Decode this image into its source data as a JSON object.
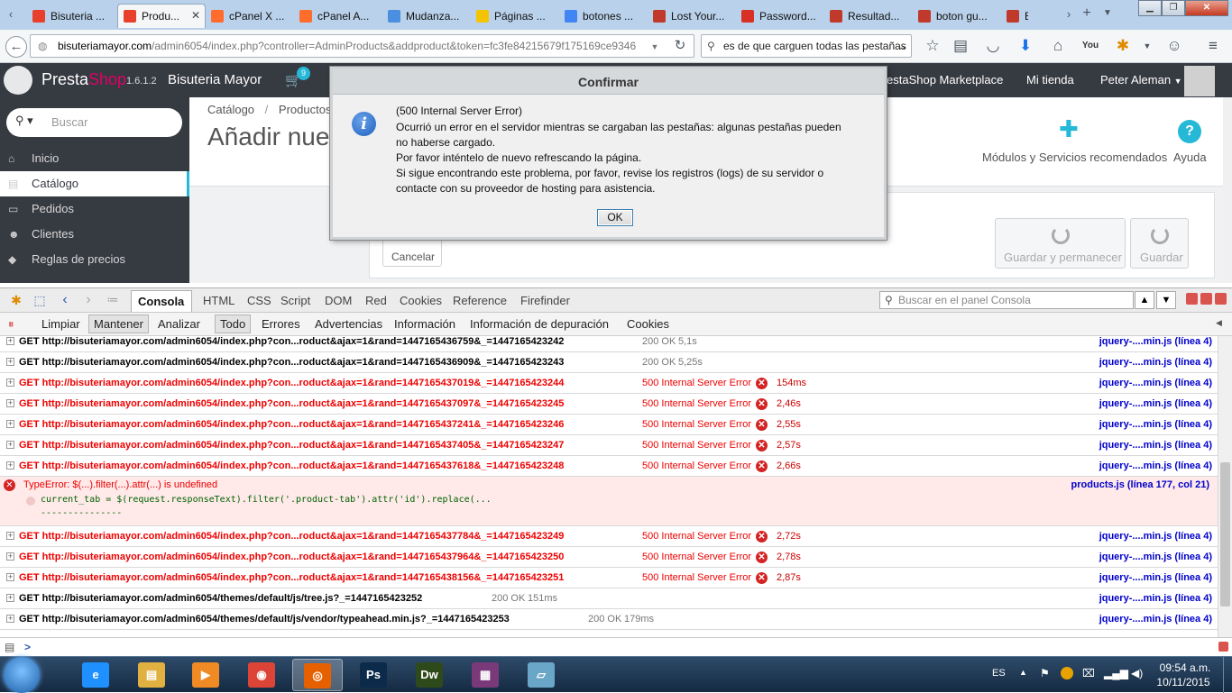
{
  "browser": {
    "tabs": [
      {
        "label": "Bisuteria ...",
        "color": "#e8402c"
      },
      {
        "label": "Produ...",
        "color": "#e8402c"
      },
      {
        "label": "cPanel X ...",
        "color": "#ff6c2c"
      },
      {
        "label": "cPanel A...",
        "color": "#ff6c2c"
      },
      {
        "label": "Mudanza...",
        "color": "#4a8fe0"
      },
      {
        "label": "Páginas ...",
        "color": "#f5c400"
      },
      {
        "label": "botones ...",
        "color": "#4285f4"
      },
      {
        "label": "Lost Your...",
        "color": "#c0392b"
      },
      {
        "label": "Password...",
        "color": "#d93025"
      },
      {
        "label": "Resultad...",
        "color": "#c0392b"
      },
      {
        "label": "boton gu...",
        "color": "#c0392b"
      },
      {
        "label": "B",
        "color": "#c0392b"
      }
    ],
    "url_domain": "bisuteriamayor.com",
    "url_path": "/admin6054/index.php?controller=AdminProducts&addproduct&token=fc3fe84215679f175169ce9346",
    "search_value": "es de que carguen todas las pestañas"
  },
  "prestashop": {
    "brand_presta": "Presta",
    "brand_shop": "Shop",
    "version": "1.6.1.2",
    "shop_name": "Bisuteria Mayor",
    "cart_badge": "9",
    "marketplace": "estaShop Marketplace",
    "my_shop": "Mi tienda",
    "user": "Peter Aleman",
    "search_placeholder": "Buscar",
    "sidebar": [
      {
        "label": "Inicio",
        "icon": "⌂"
      },
      {
        "label": "Catálogo",
        "icon": "▤"
      },
      {
        "label": "Pedidos",
        "icon": "▭"
      },
      {
        "label": "Clientes",
        "icon": "☻"
      },
      {
        "label": "Reglas de precios",
        "icon": "◆"
      }
    ],
    "breadcrumb_1": "Catálogo",
    "breadcrumb_sep": "/",
    "breadcrumb_2": "Productos",
    "page_title": "Añadir nue",
    "modules_label": "Módulos y Servicios recomendados",
    "help_label": "Ayuda",
    "cancel_label": "Cancelar",
    "save_stay_label": "Guardar y permanecer",
    "save_label": "Guardar"
  },
  "dialog": {
    "title": "Confirmar",
    "lines": [
      "(500 Internal Server Error)",
      "Ocurrió un error en el servidor mientras se cargaban las pestañas: algunas pestañas pueden",
      "no haberse cargado.",
      "Por favor inténtelo de nuevo refrescando la página.",
      "Si sigue encontrando este problema, por favor, revise los registros (logs) de su servidor o",
      "contacte con su proveedor de hosting para asistencia."
    ],
    "ok_label": "OK"
  },
  "firebug": {
    "tabs": [
      "Consola",
      "HTML",
      "CSS",
      "Script",
      "DOM",
      "Red",
      "Cookies",
      "Reference",
      "Firefinder"
    ],
    "search_placeholder": "Buscar en el panel Consola",
    "subtabs": [
      "Limpiar",
      "Mantener",
      "Analizar",
      "Todo",
      "Errores",
      "Advertencias",
      "Información",
      "Información de depuración",
      "Cookies"
    ],
    "rows_top": [
      {
        "url": "GET http://bisuteriamayor.com/admin6054/index.php?con...roduct&ajax=1&rand=1447165436759&_=1447165423242",
        "status": "200 OK",
        "time": "5,1s",
        "src": "jquery-....min.js (línea 4)",
        "ok": true
      },
      {
        "url": "GET http://bisuteriamayor.com/admin6054/index.php?con...roduct&ajax=1&rand=1447165436909&_=1447165423243",
        "status": "200 OK",
        "time": "5,25s",
        "src": "jquery-....min.js (línea 4)",
        "ok": true
      },
      {
        "url": "GET http://bisuteriamayor.com/admin6054/index.php?con...roduct&ajax=1&rand=1447165437019&_=1447165423244",
        "status": "500 Internal Server Error",
        "time": "154ms",
        "src": "jquery-....min.js (línea 4)",
        "ok": false
      },
      {
        "url": "GET http://bisuteriamayor.com/admin6054/index.php?con...roduct&ajax=1&rand=1447165437097&_=1447165423245",
        "status": "500 Internal Server Error",
        "time": "2,46s",
        "src": "jquery-....min.js (línea 4)",
        "ok": false
      },
      {
        "url": "GET http://bisuteriamayor.com/admin6054/index.php?con...roduct&ajax=1&rand=1447165437241&_=1447165423246",
        "status": "500 Internal Server Error",
        "time": "2,55s",
        "src": "jquery-....min.js (línea 4)",
        "ok": false
      },
      {
        "url": "GET http://bisuteriamayor.com/admin6054/index.php?con...roduct&ajax=1&rand=1447165437405&_=1447165423247",
        "status": "500 Internal Server Error",
        "time": "2,57s",
        "src": "jquery-....min.js (línea 4)",
        "ok": false
      },
      {
        "url": "GET http://bisuteriamayor.com/admin6054/index.php?con...roduct&ajax=1&rand=1447165437618&_=1447165423248",
        "status": "500 Internal Server Error",
        "time": "2,66s",
        "src": "jquery-....min.js (línea 4)",
        "ok": false
      }
    ],
    "type_error": {
      "msg": "TypeError: $(...).filter(...).attr(...) is undefined",
      "code": "current_tab = $(request.responseText).filter('.product-tab').attr('id').replace(...",
      "dashes": "---------------",
      "src": "products.js (línea 177, col 21)"
    },
    "rows_bottom": [
      {
        "url": "GET http://bisuteriamayor.com/admin6054/index.php?con...roduct&ajax=1&rand=1447165437784&_=1447165423249",
        "status": "500 Internal Server Error",
        "time": "2,72s",
        "src": "jquery-....min.js (línea 4)",
        "ok": false
      },
      {
        "url": "GET http://bisuteriamayor.com/admin6054/index.php?con...roduct&ajax=1&rand=1447165437964&_=1447165423250",
        "status": "500 Internal Server Error",
        "time": "2,78s",
        "src": "jquery-....min.js (línea 4)",
        "ok": false
      },
      {
        "url": "GET http://bisuteriamayor.com/admin6054/index.php?con...roduct&ajax=1&rand=1447165438156&_=1447165423251",
        "status": "500 Internal Server Error",
        "time": "2,87s",
        "src": "jquery-....min.js (línea 4)",
        "ok": false
      },
      {
        "url": "GET http://bisuteriamayor.com/admin6054/themes/default/js/tree.js?_=1447165423252",
        "status": "200 OK",
        "time": "151ms",
        "src": "jquery-....min.js (línea 4)",
        "ok": true
      },
      {
        "url": "GET http://bisuteriamayor.com/admin6054/themes/default/js/vendor/typeahead.min.js?_=1447165423253",
        "status": "200 OK",
        "time": "179ms",
        "src": "jquery-....min.js (línea 4)",
        "ok": true
      }
    ],
    "prompt": ">"
  },
  "taskbar": {
    "lang": "ES",
    "time": "09:54 a.m.",
    "date": "10/11/2015",
    "apps": [
      {
        "label": "e",
        "color": "#1e90ff"
      },
      {
        "label": "▤",
        "color": "#e0b040"
      },
      {
        "label": "▶",
        "color": "#f08a24"
      },
      {
        "label": "◉",
        "color": "#db4437"
      },
      {
        "label": "◎",
        "color": "#e66000"
      },
      {
        "label": "Ps",
        "color": "#0c2a4a"
      },
      {
        "label": "Dw",
        "color": "#2f4a1a"
      },
      {
        "label": "▦",
        "color": "#7a3a7a"
      },
      {
        "label": "▱",
        "color": "#6aa6c8"
      }
    ]
  }
}
